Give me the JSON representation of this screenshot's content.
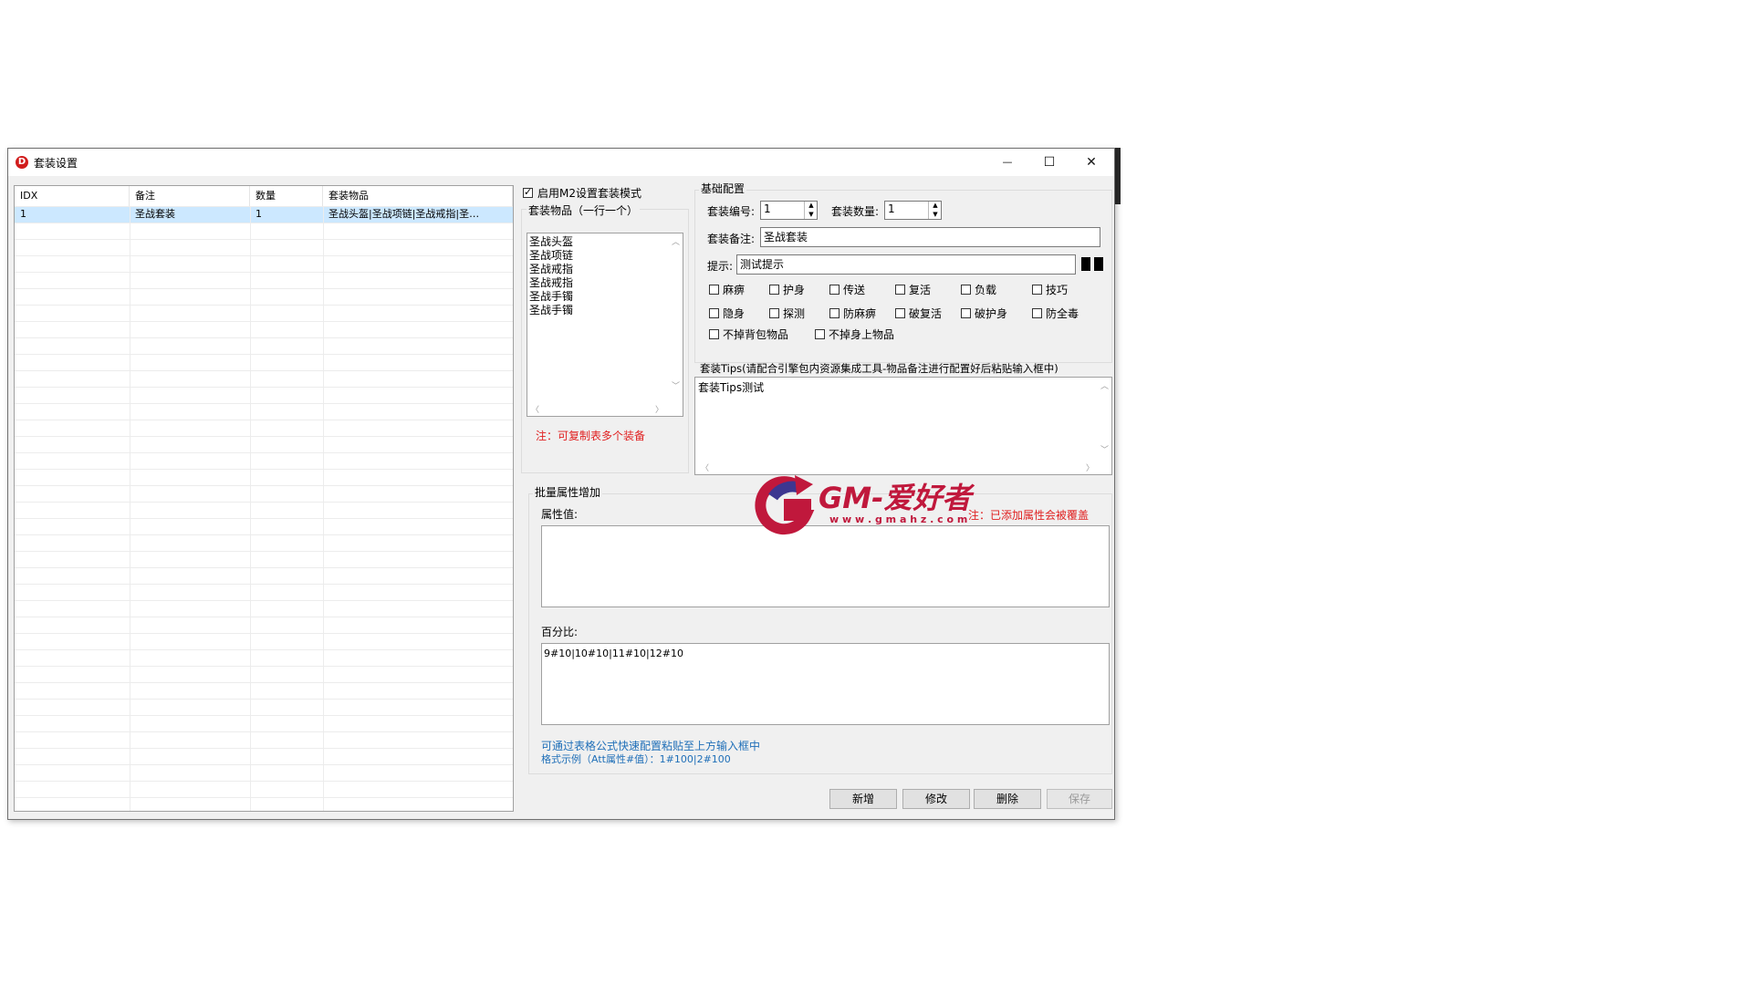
{
  "window": {
    "title": "套装设置",
    "app_icon_glyph": "D",
    "controls": {
      "minimize": "—",
      "maximize": "☐",
      "close": "✕"
    }
  },
  "list": {
    "columns": [
      "IDX",
      "备注",
      "数量",
      "套装物品"
    ],
    "rows": [
      [
        "1",
        "圣战套装",
        "1",
        "圣战头盔|圣战项链|圣战戒指|圣…"
      ]
    ]
  },
  "left_panel": {
    "enable_m2_label": "启用M2设置套装模式",
    "enable_m2_checked": true,
    "items_group_label": "套装物品（一行一个）",
    "items": [
      "圣战头盔",
      "圣战项链",
      "圣战戒指",
      "圣战戒指",
      "圣战手镯",
      "圣战手镯"
    ],
    "note": "注：可复制表多个装备"
  },
  "basic": {
    "group_label": "基础配置",
    "set_no_label": "套装编号:",
    "set_no_value": "1",
    "set_count_label": "套装数量:",
    "set_count_value": "1",
    "remark_label": "套装备注:",
    "remark_value": "圣战套装",
    "hint_label": "提示:",
    "hint_value": "测试提示",
    "checkboxes_row1": [
      "麻痹",
      "护身",
      "传送",
      "复活",
      "负载",
      "技巧"
    ],
    "checkboxes_row2": [
      "隐身",
      "探测",
      "防麻痹",
      "破复活",
      "破护身",
      "防全毒"
    ],
    "checkboxes_row3": [
      "不掉背包物品",
      "不掉身上物品"
    ]
  },
  "tips": {
    "label": "套装Tips(请配合引擎包内资源集成工具-物品备注进行配置好后粘贴输入框中)",
    "value": "套装Tips测试"
  },
  "batch": {
    "group_label": "批量属性增加",
    "attr_label": "属性值:",
    "attr_note": "注：已添加属性会被覆盖",
    "percent_label": "百分比:",
    "percent_value": "9#10|10#10|11#10|12#10",
    "help_line1": "可通过表格公式快速配置粘贴至上方输入框中",
    "help_line2": "格式示例（Att属性#值）：1#100|2#100"
  },
  "buttons": {
    "add": "新增",
    "edit": "修改",
    "delete": "删除",
    "save": "保存"
  },
  "watermark": {
    "brand": "GM-爱好者",
    "url": "w w w . g m a h z . c o m"
  },
  "colors": {
    "selection": "#cce8ff",
    "note_red": "#e02020",
    "help_blue": "#1f6fb8"
  }
}
